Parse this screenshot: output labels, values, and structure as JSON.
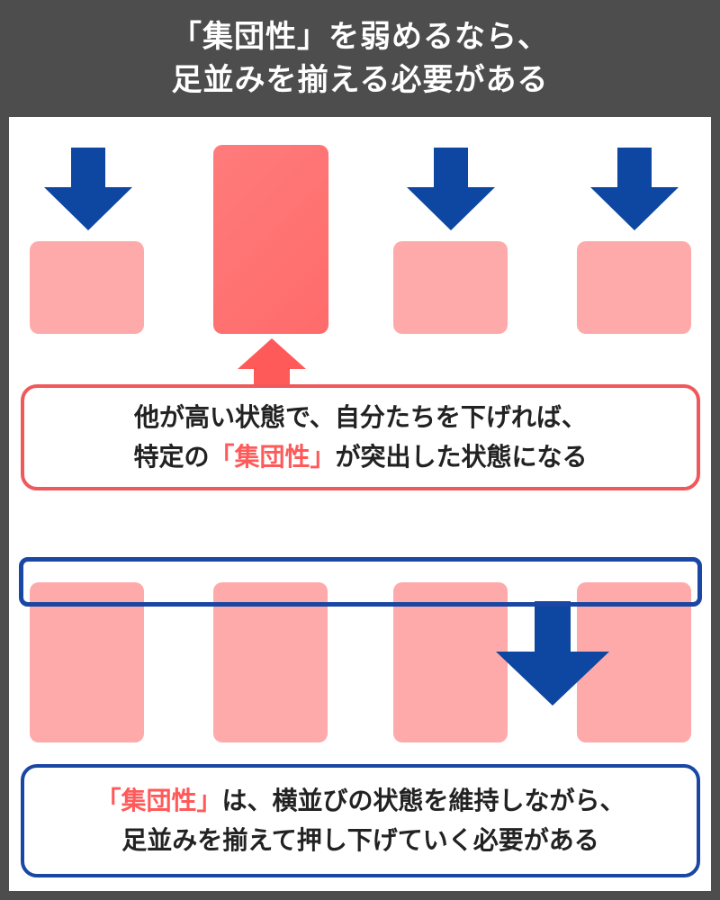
{
  "header": {
    "line1": "「集団性」を弱めるなら、",
    "line2": "足並みを揃える必要がある"
  },
  "top_callout": {
    "line1": "他が高い状態で、自分たちを下げれば、",
    "line2_prefix": "特定の",
    "line2_highlight": "「集団性」",
    "line2_suffix": "が突出した状態になる"
  },
  "bottom_callout": {
    "line1_highlight": "「集団性」",
    "line1_suffix": "は、横並びの状態を維持しながら、",
    "line2": "足並みを揃えて押し下げていく必要がある"
  },
  "colors": {
    "header_bg": "#4d4d4d",
    "block": "#ffaaaa",
    "block_raised": "#ff6b6b",
    "arrow_blue": "#0d47a1",
    "arrow_red": "#ff5a5a",
    "highlight": "#ff5a5a",
    "frame_blue": "#1a47a3"
  },
  "icons": {
    "down_arrow": "arrow-down-icon",
    "up_arrow": "arrow-up-icon"
  }
}
